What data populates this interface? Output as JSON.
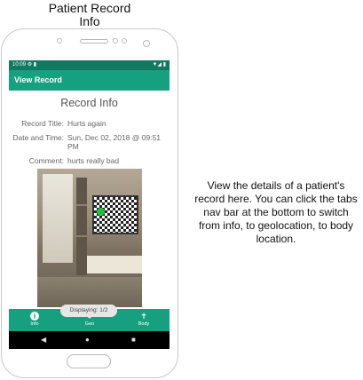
{
  "caption": {
    "title_line1": "Patient Record",
    "title_line2": "Info",
    "description": "View the details of a patient's record here. You can click the tabs nav bar at the bottom to switch from info, to geolocation, to body location."
  },
  "status_bar": {
    "time": "10:09",
    "icons": [
      "settings-icon",
      "sd-card-icon",
      "wifi-icon",
      "signal-icon",
      "battery-icon"
    ]
  },
  "app_bar": {
    "title": "View Record"
  },
  "content": {
    "heading": "Record Info",
    "fields": [
      {
        "label": "Record Title:",
        "value": "Hurts again"
      },
      {
        "label": "Date and Time:",
        "value": "Sun, Dec 02, 2018 @ 09:51 PM"
      },
      {
        "label": "Comment:",
        "value": "hurts really bad"
      }
    ]
  },
  "toast": {
    "text": "Displaying: 1/2"
  },
  "bottom_nav": {
    "items": [
      {
        "label": "Info",
        "icon": "info-icon"
      },
      {
        "label": "Geo",
        "icon": "location-icon"
      },
      {
        "label": "Body",
        "icon": "body-icon"
      }
    ],
    "selected": "Info"
  },
  "system_nav": {
    "icons": [
      "back-icon",
      "home-icon",
      "recent-apps-icon"
    ]
  },
  "colors": {
    "accent": "#16a07f",
    "status_bar": "#10795f",
    "system_nav": "#000000"
  }
}
